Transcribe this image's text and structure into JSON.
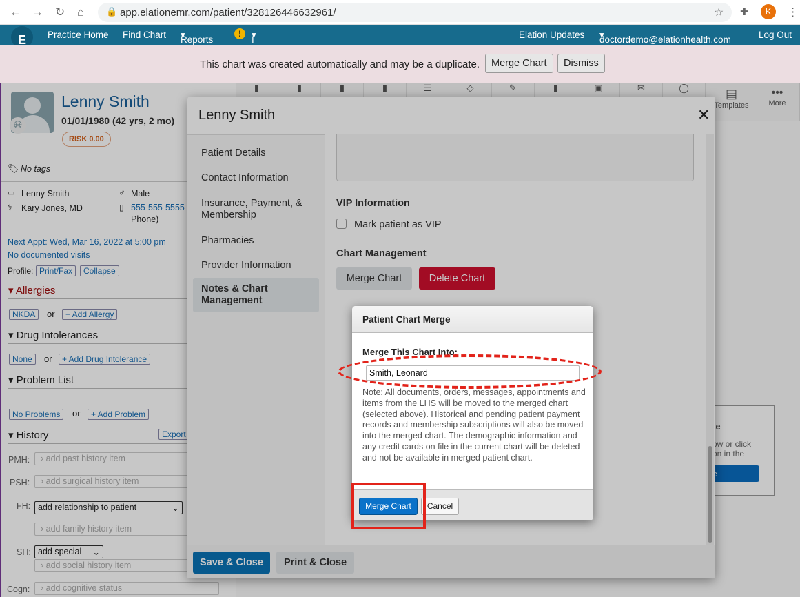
{
  "browser": {
    "url": "app.elationemr.com/patient/328126446632961/",
    "profile_initial": "K"
  },
  "nav": {
    "logo": "E",
    "items": [
      "Practice Home",
      "Find Chart",
      "Reports",
      "I need help"
    ],
    "right": [
      "Elation Updates",
      "doctordemo@elationhealth.com",
      "Log Out"
    ]
  },
  "banner": {
    "message": "This chart was created automatically and may be a duplicate.",
    "merge_label": "Merge Chart",
    "dismiss_label": "Dismiss"
  },
  "patient": {
    "name": "Lenny Smith",
    "dob": "01/01/1980 (42 yrs, 2 mo)",
    "risk": "RISK 0.00",
    "tags": "No tags",
    "display_name": "Lenny Smith",
    "sex": "Male",
    "provider": "Kary Jones, MD",
    "phone": "555-555-5555",
    "phone_type": "(Mobile Phone)",
    "phone_type_tail": "Phone)",
    "next_appt": "Next Appt: Wed, Mar 16, 2022 at 5:00 pm",
    "visits": "No documented visits",
    "profile_label": "Profile:",
    "print_fax": "Print/Fax",
    "collapse": "Collapse"
  },
  "sections": {
    "allergies": {
      "title": "Allergies",
      "none": "NKDA",
      "or": "or",
      "add": "+ Add Allergy"
    },
    "drug": {
      "title": "Drug Intolerances",
      "none": "None",
      "or": "or",
      "add": "+ Add Drug Intolerance"
    },
    "problems": {
      "title": "Problem List",
      "none": "No Problems",
      "or": "or",
      "add": "+ Add Problem"
    },
    "history": {
      "title": "History",
      "export": "Export",
      "pmh_label": "PMH:",
      "pmh": "add past history item",
      "psh_label": "PSH:",
      "psh": "add surgical history item",
      "fh_label": "FH:",
      "fh_select": "add relationship to patient",
      "fh": "add family history item",
      "sh_label": "SH:",
      "sh_select": "add special",
      "sh": "add social history item",
      "cogn_label": "Cogn:",
      "cogn": "add cognitive status"
    }
  },
  "toolbar": {
    "templates": "Templates",
    "more": "More"
  },
  "bg_panel": {
    "title_tail": "te",
    "text1": "ow or click",
    "text2": "on in the",
    "btn_tail": "e"
  },
  "modal": {
    "title": "Lenny Smith",
    "nav": [
      "Patient Details",
      "Contact Information",
      "Insurance, Payment, & Membership",
      "Pharmacies",
      "Provider Information",
      "Notes & Chart Management"
    ],
    "active_index": 5,
    "vip_title": "VIP Information",
    "vip_label": "Mark patient as VIP",
    "vip_checked": false,
    "chart_mgmt_title": "Chart Management",
    "merge_label": "Merge Chart",
    "delete_label": "Delete Chart",
    "save_close": "Save & Close",
    "print_close": "Print & Close"
  },
  "merge_dialog": {
    "title": "Patient Chart Merge",
    "field_label": "Merge This Chart Into:",
    "field_value": "Smith, Leonard",
    "note": "Note: All documents, orders, messages, appointments and items from the LHS will be moved to the merged chart (selected above). Historical and pending patient payment records and membership subscriptions will also be moved into the merged chart. The demographic information and any credit cards on file in the current chart will be deleted and not be available in merged patient chart.",
    "merge_button": "Merge Chart",
    "cancel_button": "Cancel"
  },
  "colors": {
    "nav": "#176b8d",
    "primary": "#0a72c9",
    "danger": "#d0102f",
    "annotation": "#e2231a",
    "patient_name": "#1a5f99"
  }
}
